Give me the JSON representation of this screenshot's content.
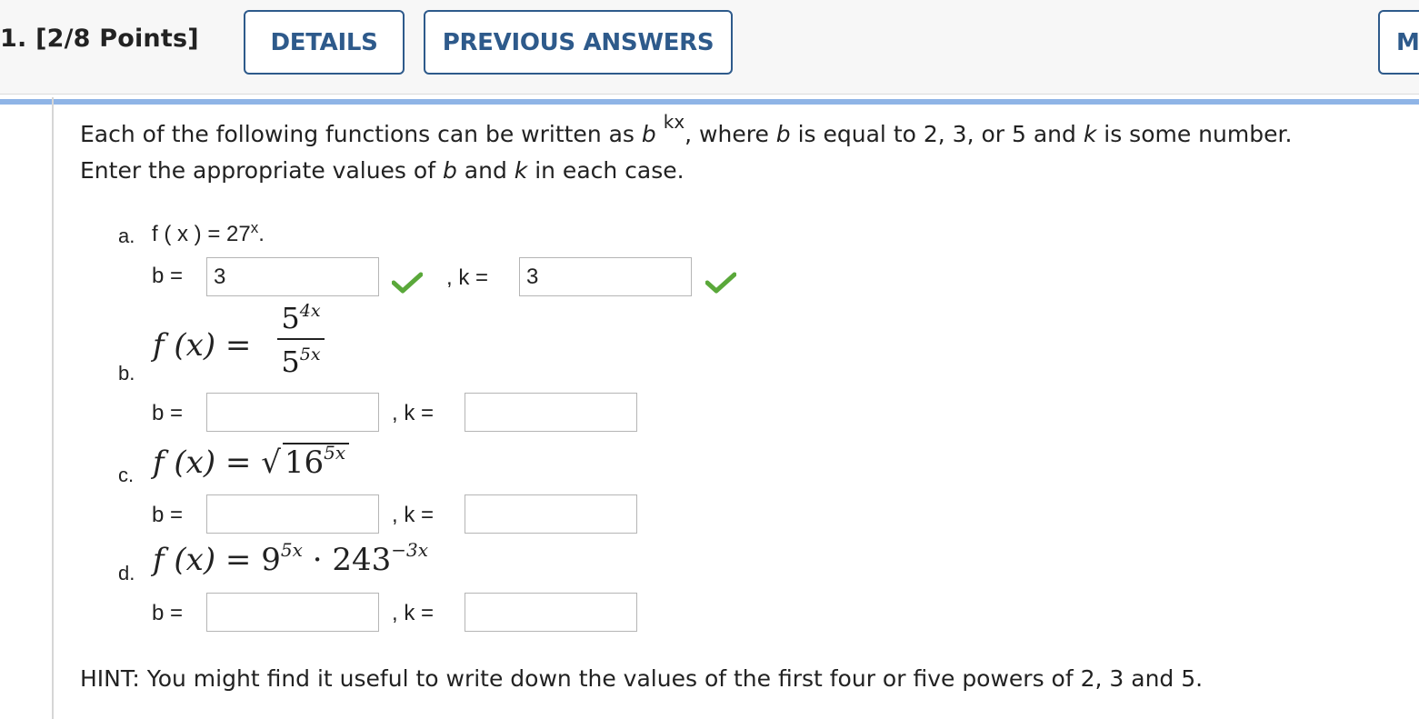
{
  "header": {
    "question_number": "1.",
    "points": "[2/8 Points]",
    "details_label": "DETAILS",
    "previous_answers_label": "PREVIOUS ANSWERS",
    "clipped_button_label": "M"
  },
  "prompt": {
    "line1_a": "Each of the following functions can be written as ",
    "base_var": "b",
    "exponent": "kx",
    "line1_b": ", where ",
    "line1_c": " is equal to 2, 3, or 5 and ",
    "k_var": "k",
    "line1_d": " is some number.",
    "line2_a": "Enter the appropriate values of ",
    "line2_b": " and ",
    "line2_c": " in each case."
  },
  "parts": [
    {
      "label": "a.",
      "function_text": "f ( x ) = 27",
      "function_exp": "x",
      "function_tail": ".",
      "b_value": "3",
      "k_value": "3",
      "b_correct": true,
      "k_correct": true
    },
    {
      "label": "b.",
      "lhs": "f (x) =",
      "numerator_base": "5",
      "numerator_exp": "4x",
      "denominator_base": "5",
      "denominator_exp": "5x",
      "b_value": "",
      "k_value": ""
    },
    {
      "label": "c.",
      "lhs": "f (x) =",
      "radicand_base": "16",
      "radicand_exp": "5x",
      "b_value": "",
      "k_value": ""
    },
    {
      "label": "d.",
      "lhs": "f (x) =",
      "base1": "9",
      "exp1": "5x",
      "dot": "·",
      "base2": "243",
      "exp2": "−3x",
      "b_value": "",
      "k_value": ""
    }
  ],
  "labels": {
    "b_eq": "b =",
    "k_eq": ", k ="
  },
  "hint": "HINT: You might find it useful to write down the values of the first four or five powers of 2, 3 and 5.",
  "colors": {
    "accent_bar": "#8fb4e6",
    "button_border": "#2e5a8b",
    "check_green": "#5aa83a"
  }
}
